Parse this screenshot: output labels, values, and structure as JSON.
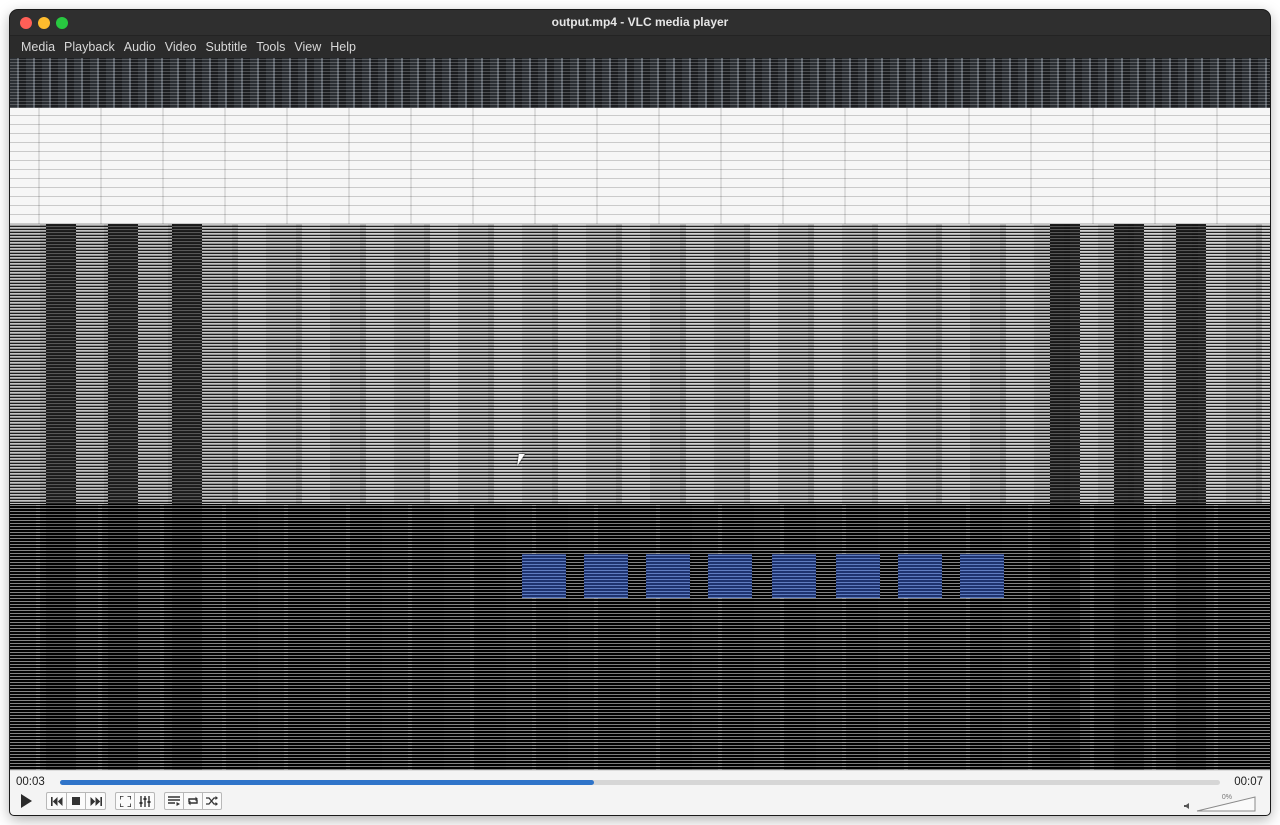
{
  "window": {
    "title": "output.mp4 - VLC media player"
  },
  "menubar": {
    "items": [
      "Media",
      "Playback",
      "Audio",
      "Video",
      "Subtitle",
      "Tools",
      "View",
      "Help"
    ]
  },
  "playback": {
    "elapsed": "00:03",
    "total": "00:07",
    "progress_fraction": 0.46
  },
  "volume": {
    "label": "0%",
    "level_percent": 0
  },
  "controls": {
    "icons": [
      "play-icon",
      "previous-icon",
      "stop-icon",
      "next-icon",
      "fullscreen-icon",
      "extended-settings-icon",
      "playlist-icon",
      "loop-icon",
      "shuffle-icon"
    ]
  },
  "colors": {
    "accent": "#2f74c9",
    "close": "#ff5f57",
    "minimize": "#febc2e",
    "maximize": "#28c840"
  }
}
